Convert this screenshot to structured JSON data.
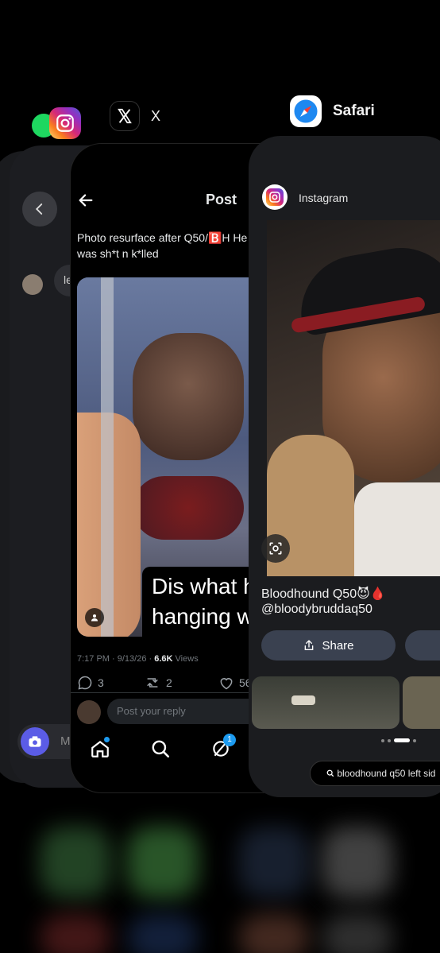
{
  "apps": {
    "x": {
      "name": "X"
    },
    "safari": {
      "name": "Safari"
    }
  },
  "x_post": {
    "header_title": "Post",
    "text": "Photo resurface after Q50/🅱️H He was sh*t n k*lled",
    "image_caption": "Dis what ha hanging wit",
    "time": "7:17 PM",
    "date": "9/13/26",
    "views_count": "6.6K",
    "views_label": "Views",
    "replies": "3",
    "reposts": "2",
    "likes": "56",
    "reply_placeholder": "Post your reply",
    "notifications_badge": "1"
  },
  "instagram_dm": {
    "message_preview": "le",
    "composer_placeholder": "Me"
  },
  "safari": {
    "site_name": "Instagram",
    "post_caption": "Bloodhound Q50😈🩸",
    "handle": "@bloodybruddaq50",
    "share_label": "Share",
    "search_query": "bloodhound q50 left sid"
  },
  "colors": {
    "x_accent": "#1d9bf0",
    "card_bg": "#1b1c1f",
    "button_bg": "#3a4150"
  },
  "icons": [
    "instagram-icon",
    "spotify-icon",
    "x-logo-icon",
    "safari-icon",
    "back-arrow-icon",
    "home-icon",
    "search-icon",
    "grok-icon",
    "camera-icon",
    "share-icon",
    "lens-icon",
    "reply-icon",
    "repost-icon",
    "like-icon",
    "chevron-left-icon"
  ]
}
